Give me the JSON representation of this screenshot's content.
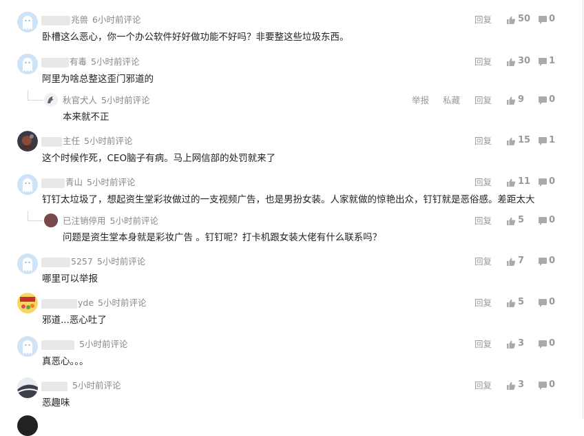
{
  "top_fragment": "…",
  "comments": [
    {
      "user": "兆兽",
      "time": "6小时前评论",
      "text": "卧槽这么恶心，你一个办公软件好好做功能不好吗？非要整这些垃圾东西。",
      "reply_label": "回复",
      "likes": "50",
      "replies": "0"
    },
    {
      "user": "有毒",
      "time": "5小时前评论",
      "text": "阿里为啥总整这歪门邪道的",
      "reply_label": "回复",
      "likes": "30",
      "replies": "1"
    },
    {
      "user": "秋官犬人",
      "time": "5小时前评论",
      "text": "本来就不正",
      "report_label": "举报",
      "private_label": "私藏",
      "reply_label": "回复",
      "likes": "9",
      "replies": "0"
    },
    {
      "user": "主任",
      "time": "5小时前评论",
      "text": "这个时候作死，CEO脑子有病。马上网信部的处罚就来了",
      "reply_label": "回复",
      "likes": "15",
      "replies": "1"
    },
    {
      "user": "青山",
      "time": "5小时前评论",
      "text": "钉钉太垃圾了，想起资生堂彩妆做过的一支视频广告，也是男扮女装。人家就做的惊艳出众，钉钉就是恶俗感。差距太大",
      "reply_label": "回复",
      "likes": "11",
      "replies": "0"
    },
    {
      "user": "已注销停用",
      "time": "5小时前评论",
      "text": "问题是资生堂本身就是彩妆广告 。钉钉呢？打卡机跟女装大佬有什么联系吗？",
      "reply_label": "回复",
      "likes": "5",
      "replies": "0"
    },
    {
      "user": "5257",
      "time": "5小时前评论",
      "text": "哪里可以举报",
      "reply_label": "回复",
      "likes": "7",
      "replies": "0"
    },
    {
      "user": "yde",
      "time": "5小时前评论",
      "text": "邪道...恶心吐了",
      "reply_label": "回复",
      "likes": "5",
      "replies": "0"
    },
    {
      "user": "",
      "time": "5小时前评论",
      "text": "真恶心。。。",
      "reply_label": "回复",
      "likes": "3",
      "replies": "0"
    },
    {
      "user": "",
      "time": "5小时前评论",
      "text": "恶趣味",
      "reply_label": "回复",
      "likes": "3",
      "replies": "0"
    }
  ],
  "colors": {
    "ghost_avatar": "#cfe3f7",
    "text": "#222222",
    "meta": "#888888",
    "action": "#999999"
  },
  "icons": {
    "like": "thumbs-up-icon",
    "reply": "speech-bubble-icon"
  }
}
